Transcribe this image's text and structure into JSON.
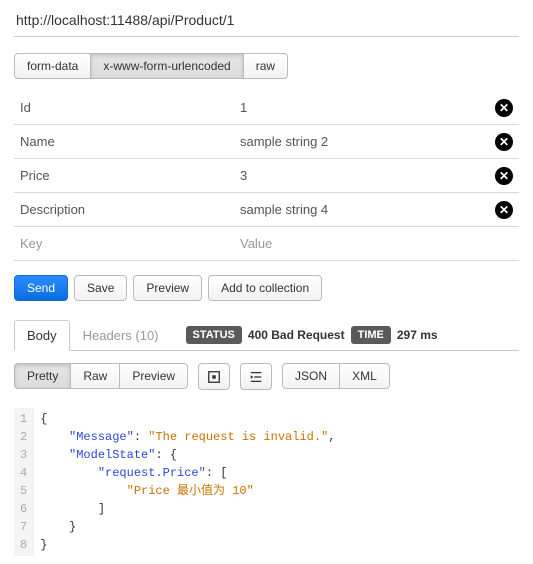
{
  "url": "http://localhost:11488/api/Product/1",
  "bodyTypes": {
    "form": "form-data",
    "url": "x-www-form-urlencoded",
    "raw": "raw"
  },
  "params": [
    {
      "key": "Id",
      "value": "1"
    },
    {
      "key": "Name",
      "value": "sample string 2"
    },
    {
      "key": "Price",
      "value": "3"
    },
    {
      "key": "Description",
      "value": "sample string 4"
    }
  ],
  "placeholders": {
    "key": "Key",
    "value": "Value"
  },
  "actions": {
    "send": "Send",
    "save": "Save",
    "preview": "Preview",
    "add": "Add to collection"
  },
  "respTabs": {
    "body": "Body",
    "headers": "Headers (10)"
  },
  "status": {
    "label": "STATUS",
    "value": "400 Bad Request",
    "timeLabel": "TIME",
    "timeValue": "297 ms"
  },
  "viewModes": {
    "pretty": "Pretty",
    "raw": "Raw",
    "preview": "Preview",
    "json": "JSON",
    "xml": "XML"
  },
  "responseJson": {
    "line1": "{",
    "k_message": "\"Message\"",
    "v_message": "\"The request is invalid.\"",
    "k_modelstate": "\"ModelState\"",
    "k_reqprice": "\"request.Price\"",
    "v_priceerr": "\"Price 最小值为 10\""
  }
}
